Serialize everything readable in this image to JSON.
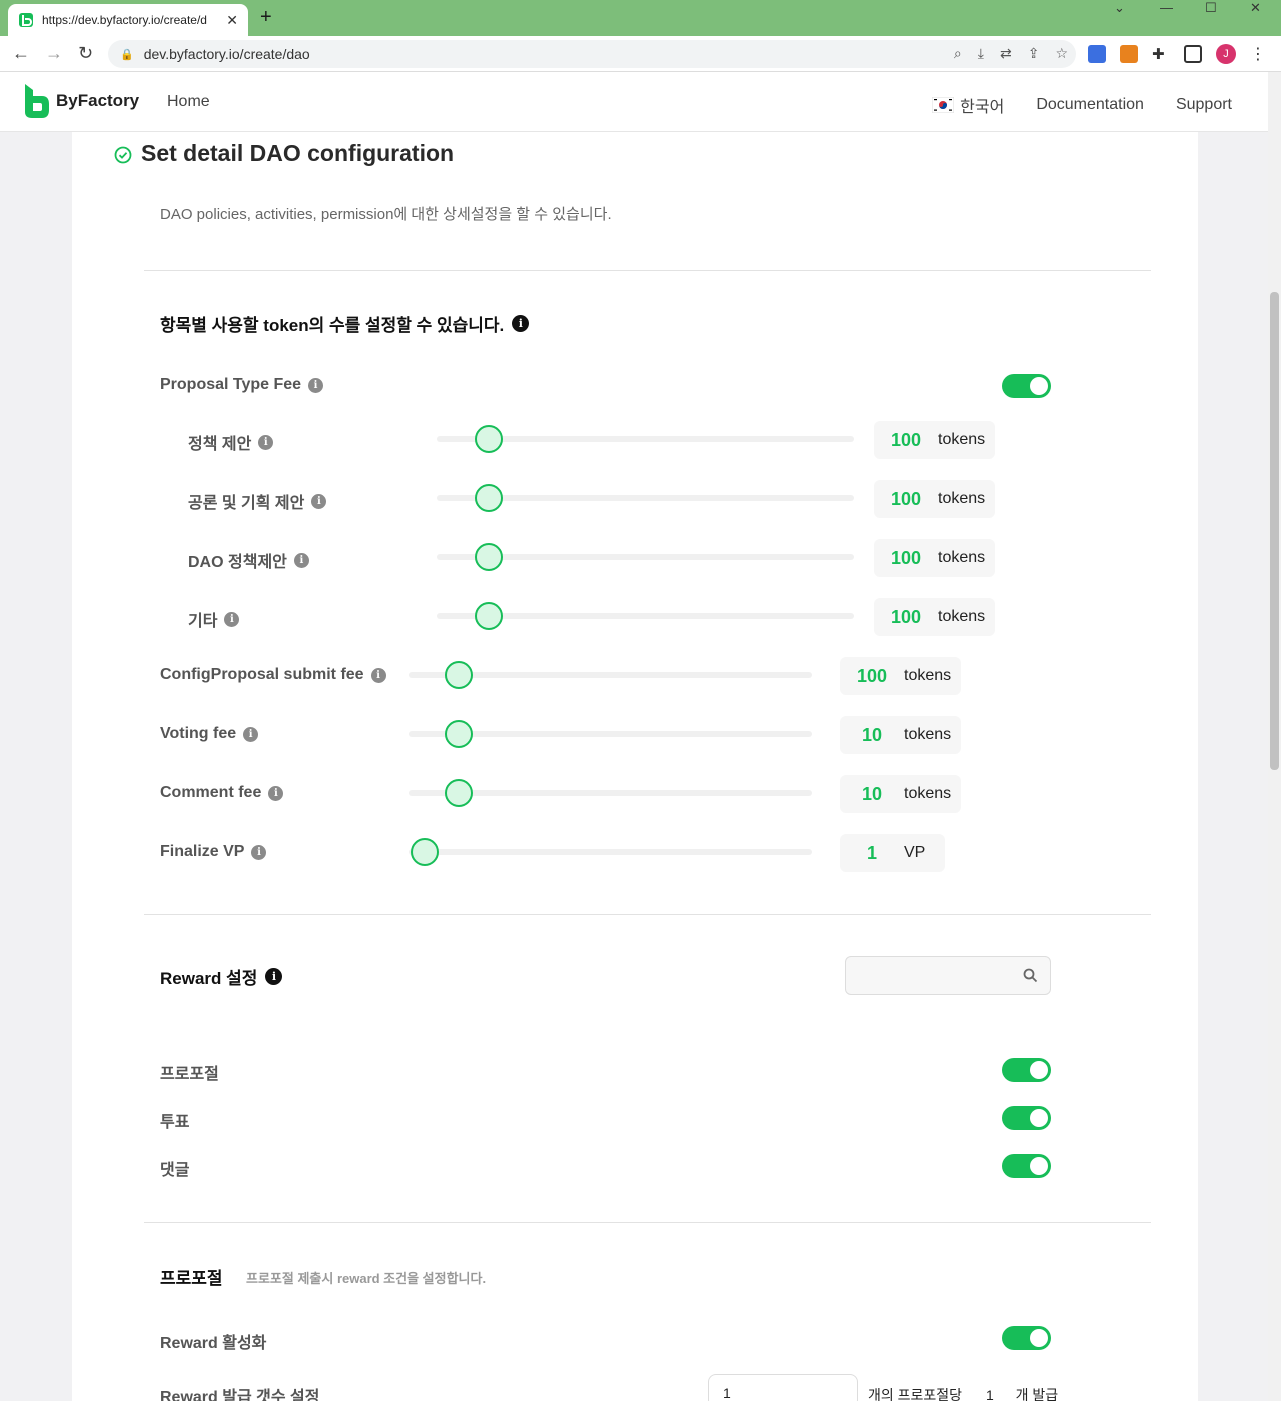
{
  "browser": {
    "tab_title": "https://dev.byfactory.io/create/d",
    "url": "dev.byfactory.io/create/dao",
    "profile_initial": "J"
  },
  "header": {
    "brand": "ByFactory",
    "home": "Home",
    "language": "한국어",
    "documentation": "Documentation",
    "support": "Support"
  },
  "page": {
    "title": "Set detail DAO configuration",
    "subtitle": "DAO policies, activities, permission에 대한 상세설정을 할 수 있습니다."
  },
  "token_section": {
    "title": "항목별 사용할 token의 수를 설정할 수 있습니다.",
    "proposal_type_fee": {
      "label": "Proposal Type Fee",
      "enabled": true
    },
    "sub_fees": [
      {
        "label": "정책 제안",
        "value": "100",
        "unit": "tokens",
        "level": 0.1
      },
      {
        "label": "공론 및 기획 제안",
        "value": "100",
        "unit": "tokens",
        "level": 0.1
      },
      {
        "label": "DAO 정책제안",
        "value": "100",
        "unit": "tokens",
        "level": 0.1
      },
      {
        "label": "기타",
        "value": "100",
        "unit": "tokens",
        "level": 0.1
      }
    ],
    "fees": [
      {
        "label": "ConfigProposal submit fee",
        "value": "100",
        "unit": "tokens",
        "level": 0.1
      },
      {
        "label": "Voting fee",
        "value": "10",
        "unit": "tokens",
        "level": 0.1
      },
      {
        "label": "Comment fee",
        "value": "10",
        "unit": "tokens",
        "level": 0.1
      },
      {
        "label": "Finalize VP",
        "value": "1",
        "unit": "VP",
        "level": 0.0
      }
    ]
  },
  "reward_section": {
    "title": "Reward 설정",
    "search_placeholder": "",
    "items": [
      {
        "label": "프로포절",
        "enabled": true
      },
      {
        "label": "투표",
        "enabled": true
      },
      {
        "label": "댓글",
        "enabled": true
      }
    ]
  },
  "proposal_section": {
    "title": "프로포절",
    "description": "프로포절 제출시 reward 조건을 설정합니다.",
    "reward_enable_label": "Reward 활성화",
    "reward_enabled": true,
    "reward_count_label": "Reward 발급 갯수 설정",
    "reward_count_input": "1",
    "per_proposal_text": "개의 프로포절당",
    "issue_count": "1",
    "issue_suffix": "개 발급"
  },
  "colors": {
    "accent": "#17bd58",
    "tabbar": "#7dbe7a"
  }
}
